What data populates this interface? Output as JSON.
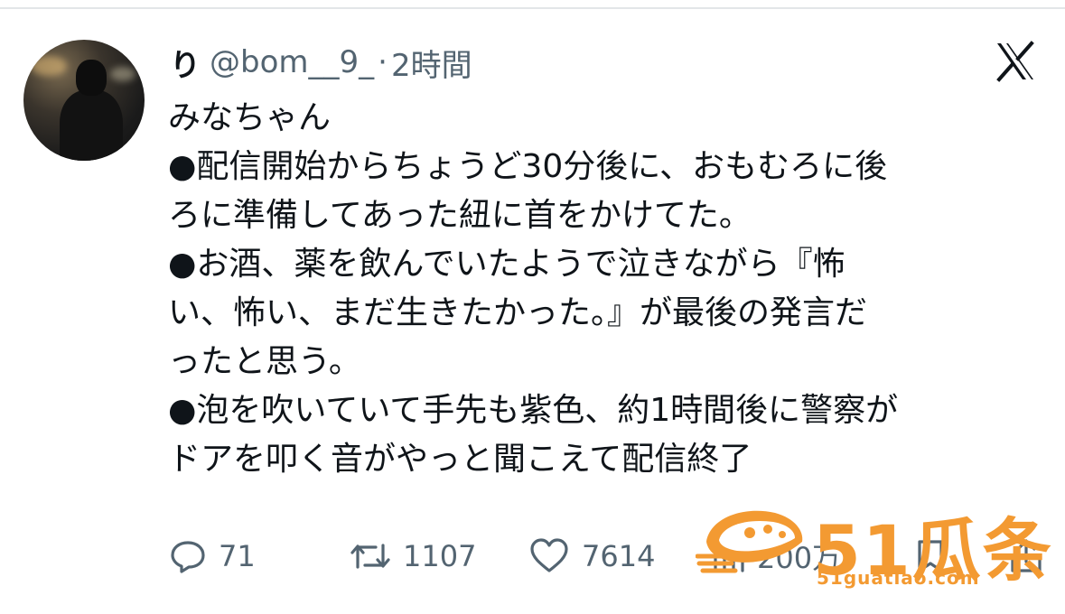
{
  "tweet": {
    "display_name": "り",
    "handle": "@bom__9_",
    "separator": "·",
    "time": "2時間",
    "lines": [
      "みなちゃん",
      "●配信開始からちょうど30分後に、おもむろに後",
      "ろに準備してあった紐に首をかけてた。",
      "●お酒、薬を飲んでいたようで泣きながら『怖",
      "い、怖い、まだ生きたかった。』が最後の発言だ",
      "ったと思う。",
      "●泡を吹いていて手先も紫色、約1時間後に警察が",
      "ドアを叩く音がやっと聞こえて配信終了"
    ]
  },
  "actions": {
    "replies": "71",
    "reposts": "1107",
    "likes": "7614",
    "views": "200万"
  },
  "watermark": {
    "text": "51瓜条",
    "url": "51guatiao.com"
  },
  "colors": {
    "text": "#0f1419",
    "muted": "#536471",
    "watermark": "#f39a32"
  }
}
